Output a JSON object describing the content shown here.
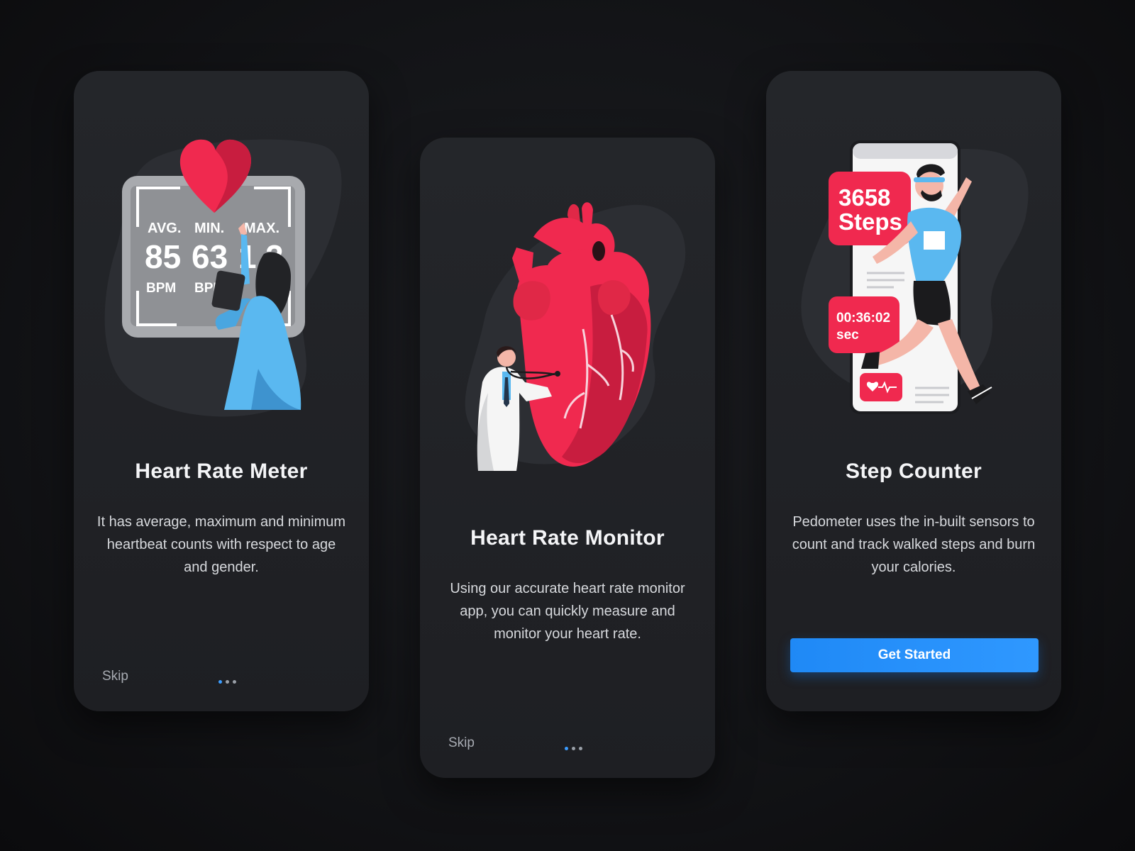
{
  "cards": [
    {
      "title": "Heart Rate Meter",
      "description": "It has average, maximum and minimum heartbeat counts with respect to age and gender.",
      "skip_label": "Skip",
      "page_dots": 3,
      "active_dot": 1,
      "illustration": {
        "avg_label": "AVG.",
        "min_label": "MIN.",
        "max_label": "MAX.",
        "avg_value": "85",
        "min_value": "63",
        "max_value": "1",
        "max_value_end": "2",
        "unit_1": "BPM",
        "unit_2": "BPM"
      }
    },
    {
      "title": "Heart Rate Monitor",
      "description": "Using our accurate heart rate monitor app, you can quickly measure and monitor your heart rate.",
      "skip_label": "Skip",
      "page_dots": 3,
      "active_dot": 1
    },
    {
      "title": "Step Counter",
      "description": "Pedometer uses the in-built sensors to count and track walked steps and burn your calories.",
      "button_label": "Get Started",
      "illustration": {
        "steps_value": "3658",
        "steps_label": "Steps",
        "timer_value": "00:36:02",
        "timer_unit": "sec"
      }
    }
  ],
  "colors": {
    "accent_red": "#f0294f",
    "accent_blue": "#2f98ff",
    "card_bg": "#222428",
    "light_blue": "#5ab8f0"
  }
}
